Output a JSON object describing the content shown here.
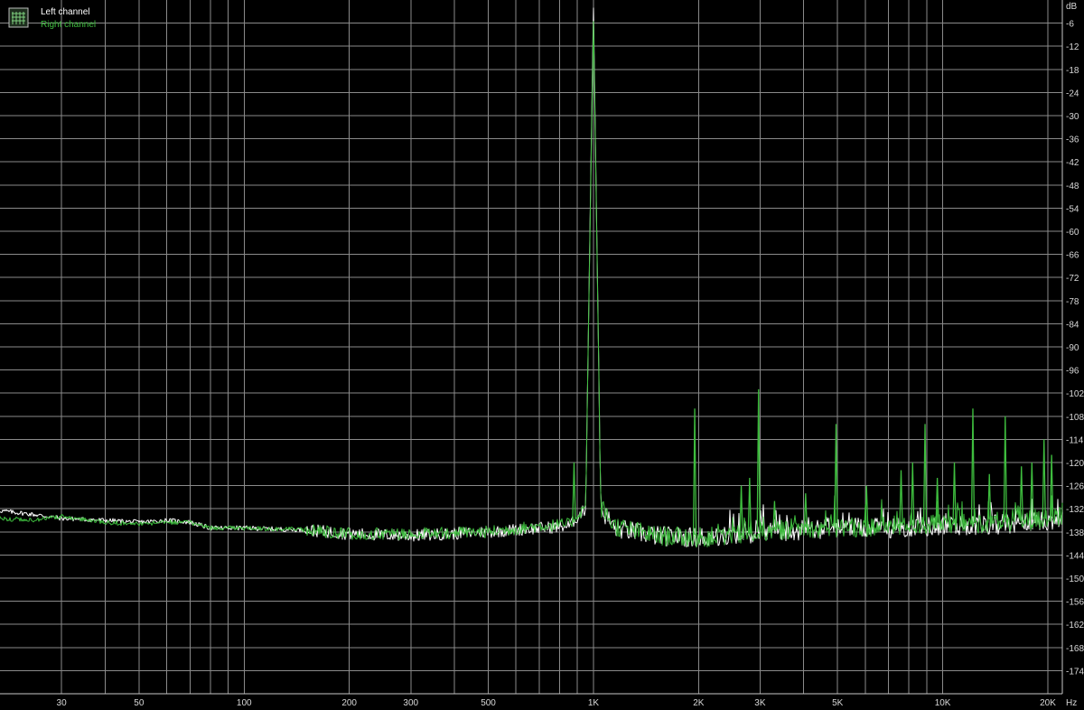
{
  "chart_data": {
    "type": "line",
    "title": "",
    "xlabel": "",
    "ylabel": "",
    "x_unit": "Hz",
    "y_unit": "dB",
    "x_scale": "log",
    "xlim": [
      20,
      22000
    ],
    "ylim": [
      -180,
      0
    ],
    "grid": true,
    "legend_position": "top-left",
    "background_color": "#000000",
    "grid_color": "#8a8a8a",
    "x_ticks": [
      {
        "value": 30,
        "label": "30"
      },
      {
        "value": 50,
        "label": "50"
      },
      {
        "value": 100,
        "label": "100"
      },
      {
        "value": 200,
        "label": "200"
      },
      {
        "value": 300,
        "label": "300"
      },
      {
        "value": 500,
        "label": "500"
      },
      {
        "value": 1000,
        "label": "1K"
      },
      {
        "value": 2000,
        "label": "2K"
      },
      {
        "value": 3000,
        "label": "3K"
      },
      {
        "value": 5000,
        "label": "5K"
      },
      {
        "value": 10000,
        "label": "10K"
      },
      {
        "value": 20000,
        "label": "20K"
      }
    ],
    "y_ticks": [
      -6,
      -12,
      -18,
      -24,
      -30,
      -36,
      -42,
      -48,
      -54,
      -60,
      -66,
      -72,
      -78,
      -84,
      -90,
      -96,
      -102,
      -108,
      -114,
      -120,
      -126,
      -132,
      -138,
      -144,
      -150,
      -156,
      -162,
      -168,
      -174
    ],
    "series": [
      {
        "name": "Left channel",
        "color": "#ffffff",
        "points": [
          [
            20,
            -132.5
          ],
          [
            25,
            -133.5
          ],
          [
            30,
            -134.5
          ],
          [
            40,
            -135
          ],
          [
            50,
            -135.5
          ],
          [
            60,
            -135
          ],
          [
            70,
            -135.5
          ],
          [
            80,
            -137
          ],
          [
            100,
            -137
          ],
          [
            150,
            -137.5
          ],
          [
            200,
            -138.5
          ],
          [
            300,
            -139
          ],
          [
            500,
            -138
          ],
          [
            700,
            -137
          ],
          [
            850,
            -136.5
          ],
          [
            950,
            -132
          ],
          [
            1000,
            -1
          ],
          [
            1050,
            -132
          ],
          [
            1150,
            -137
          ],
          [
            1500,
            -139
          ],
          [
            2000,
            -139.5
          ],
          [
            2500,
            -139
          ],
          [
            3000,
            -138
          ],
          [
            4000,
            -137.5
          ],
          [
            5000,
            -137
          ],
          [
            7000,
            -137
          ],
          [
            10000,
            -136.5
          ],
          [
            15000,
            -136
          ],
          [
            20000,
            -135
          ],
          [
            22000,
            -134.5
          ]
        ],
        "spurs": []
      },
      {
        "name": "Right channel",
        "color": "#3ebd3e",
        "points": [
          [
            20,
            -134.5
          ],
          [
            25,
            -135
          ],
          [
            30,
            -134
          ],
          [
            40,
            -135.5
          ],
          [
            50,
            -136
          ],
          [
            60,
            -135.5
          ],
          [
            70,
            -135.5
          ],
          [
            80,
            -137
          ],
          [
            100,
            -137
          ],
          [
            150,
            -137.5
          ],
          [
            200,
            -138.5
          ],
          [
            300,
            -138.5
          ],
          [
            500,
            -138
          ],
          [
            700,
            -136.5
          ],
          [
            850,
            -136
          ],
          [
            950,
            -131.5
          ],
          [
            1000,
            -4.5
          ],
          [
            1050,
            -131.5
          ],
          [
            1150,
            -136.5
          ],
          [
            1500,
            -139
          ],
          [
            2000,
            -139.5
          ],
          [
            2500,
            -139
          ],
          [
            3000,
            -138
          ],
          [
            4000,
            -137
          ],
          [
            5000,
            -137
          ],
          [
            7000,
            -136.5
          ],
          [
            10000,
            -136
          ],
          [
            15000,
            -135.5
          ],
          [
            20000,
            -134.5
          ],
          [
            22000,
            -134
          ]
        ],
        "spurs": [
          [
            880,
            -120
          ],
          [
            1950,
            -106
          ],
          [
            2650,
            -126
          ],
          [
            2800,
            -124
          ],
          [
            2970,
            -101
          ],
          [
            3300,
            -130
          ],
          [
            4050,
            -128
          ],
          [
            4950,
            -110
          ],
          [
            6050,
            -126
          ],
          [
            7600,
            -122
          ],
          [
            8200,
            -120
          ],
          [
            8900,
            -110
          ],
          [
            9650,
            -124
          ],
          [
            10800,
            -120
          ],
          [
            12200,
            -106
          ],
          [
            13600,
            -123
          ],
          [
            15100,
            -108
          ],
          [
            16800,
            -121
          ],
          [
            18000,
            -120
          ],
          [
            19500,
            -114
          ],
          [
            20500,
            -118
          ]
        ]
      }
    ]
  }
}
